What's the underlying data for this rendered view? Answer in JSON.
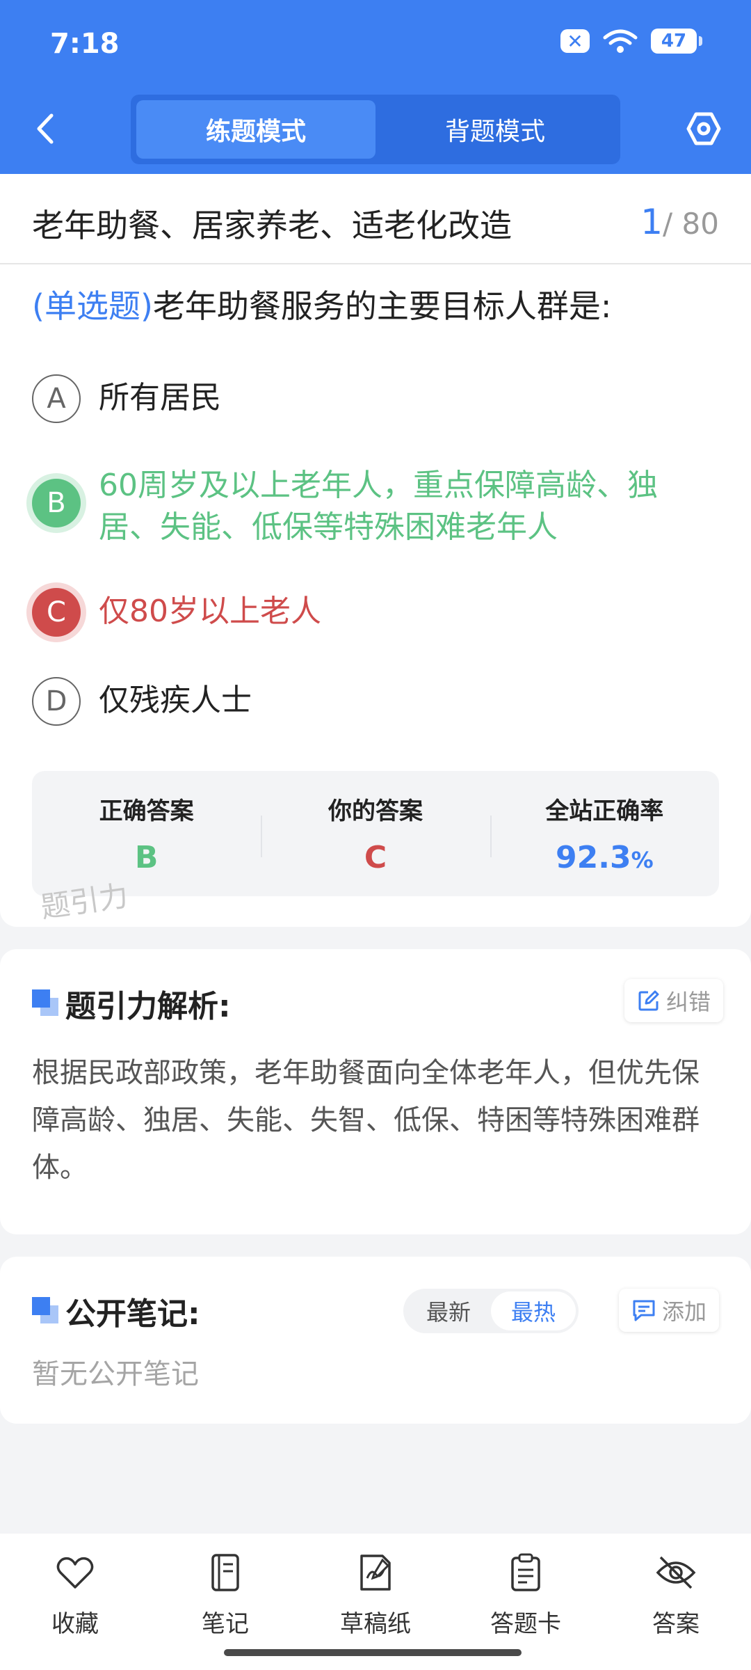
{
  "status_bar": {
    "time": "7:18",
    "battery": "47"
  },
  "header": {
    "tabs": [
      {
        "label": "练题模式",
        "active": true
      },
      {
        "label": "背题模式",
        "active": false
      }
    ],
    "back_icon": "chevron-left-icon",
    "settings_icon": "hexagon-settings-icon"
  },
  "question": {
    "chapter": "老年助餐、居家养老、适老化改造",
    "current": "1",
    "total": "/ 80",
    "type": "(单选题)",
    "text": "老年助餐服务的主要目标人群是:",
    "options": [
      {
        "letter": "A",
        "text": "所有居民",
        "state": "normal"
      },
      {
        "letter": "B",
        "text": "60周岁及以上老年人，重点保障高龄、独居、失能、低保等特殊困难老年人",
        "state": "correct"
      },
      {
        "letter": "C",
        "text": "仅80岁以上老人",
        "state": "wrong"
      },
      {
        "letter": "D",
        "text": "仅残疾人士",
        "state": "normal"
      }
    ]
  },
  "result": {
    "correct_label": "正确答案",
    "correct_value": "B",
    "yours_label": "你的答案",
    "yours_value": "C",
    "rate_label": "全站正确率",
    "rate_value": "92.3",
    "rate_unit": "%"
  },
  "watermark": "题引力",
  "analysis": {
    "title": "题引力解析:",
    "report_label": "纠错",
    "text": "根据民政部政策，老年助餐面向全体老年人，但优先保障高龄、独居、失能、失智、低保、特困等特殊困难群体。"
  },
  "notes": {
    "title": "公开笔记:",
    "sort_options": [
      {
        "label": "最新",
        "active": false
      },
      {
        "label": "最热",
        "active": true
      }
    ],
    "add_label": "添加",
    "empty_text": "暂无公开笔记"
  },
  "bottom_nav": [
    {
      "label": "收藏",
      "icon": "heart-icon"
    },
    {
      "label": "笔记",
      "icon": "notebook-icon"
    },
    {
      "label": "草稿纸",
      "icon": "draft-paper-icon"
    },
    {
      "label": "答题卡",
      "icon": "answer-sheet-icon"
    },
    {
      "label": "答案",
      "icon": "eye-off-icon"
    }
  ],
  "colors": {
    "primary": "#3d7ff2",
    "correct": "#5cc283",
    "wrong": "#cf4b4b"
  }
}
